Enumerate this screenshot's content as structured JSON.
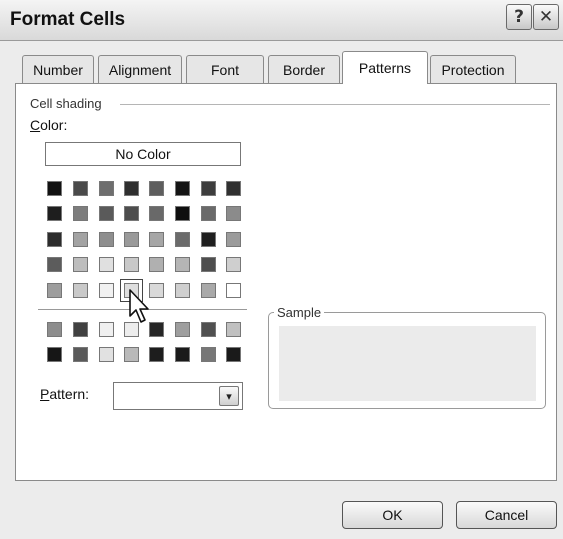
{
  "window": {
    "title": "Format Cells",
    "help_glyph": "?",
    "close_glyph": "✕"
  },
  "tabs": [
    {
      "label": "Number",
      "active": false
    },
    {
      "label": "Alignment",
      "active": false
    },
    {
      "label": "Font",
      "active": false
    },
    {
      "label": "Border",
      "active": false
    },
    {
      "label": "Patterns",
      "active": true
    },
    {
      "label": "Protection",
      "active": false
    }
  ],
  "cell_shading": {
    "group_label": "Cell shading",
    "color_label_first": "C",
    "color_label_rest": "olor:",
    "no_color_label": "No Color",
    "palette_rows": [
      [
        "#111111",
        "#4a4a4a",
        "#6e6e6e",
        "#2f2f2f",
        "#5e5e5e",
        "#141414",
        "#3d3d3d",
        "#303030"
      ],
      [
        "#1e1e1e",
        "#7d7d7d",
        "#5a5a5a",
        "#4d4d4d",
        "#696969",
        "#0f0f0f",
        "#6a6a6a",
        "#8b8b8b"
      ],
      [
        "#2c2c2c",
        "#a3a3a3",
        "#8e8e8e",
        "#9a9a9a",
        "#a6a6a6",
        "#6b6b6b",
        "#1f1f1f",
        "#9b9b9b"
      ],
      [
        "#5c5c5c",
        "#bdbdbd",
        "#e0e0e0",
        "#c8c8c8",
        "#b0b0b0",
        "#b5b5b5",
        "#4e4e4e",
        "#cfcfcf"
      ],
      [
        "#9d9d9d",
        "#c9c9c9",
        "#f1f1f1",
        "#dedede",
        "#d9d9d9",
        "#cfcfcf",
        "#a9a9a9",
        "#ffffff"
      ]
    ],
    "chart_rows": [
      [
        "#8d8d8d",
        "#414141",
        "#f0f0f0",
        "#ededed",
        "#262626",
        "#9e9e9e",
        "#505050",
        "#c0c0c0"
      ],
      [
        "#161616",
        "#5a5a5a",
        "#e1e1e1",
        "#b9b9b9",
        "#1d1d1d",
        "#1a1a1a",
        "#777777",
        "#1a1a1a"
      ]
    ],
    "selected_swatch": {
      "row": 4,
      "col": 3
    }
  },
  "pattern": {
    "label_first": "P",
    "label_rest": "attern:",
    "value": "",
    "arrow_glyph": "▾"
  },
  "sample": {
    "label": "Sample",
    "color": "#ebebeb"
  },
  "buttons": {
    "ok": "OK",
    "cancel": "Cancel"
  }
}
